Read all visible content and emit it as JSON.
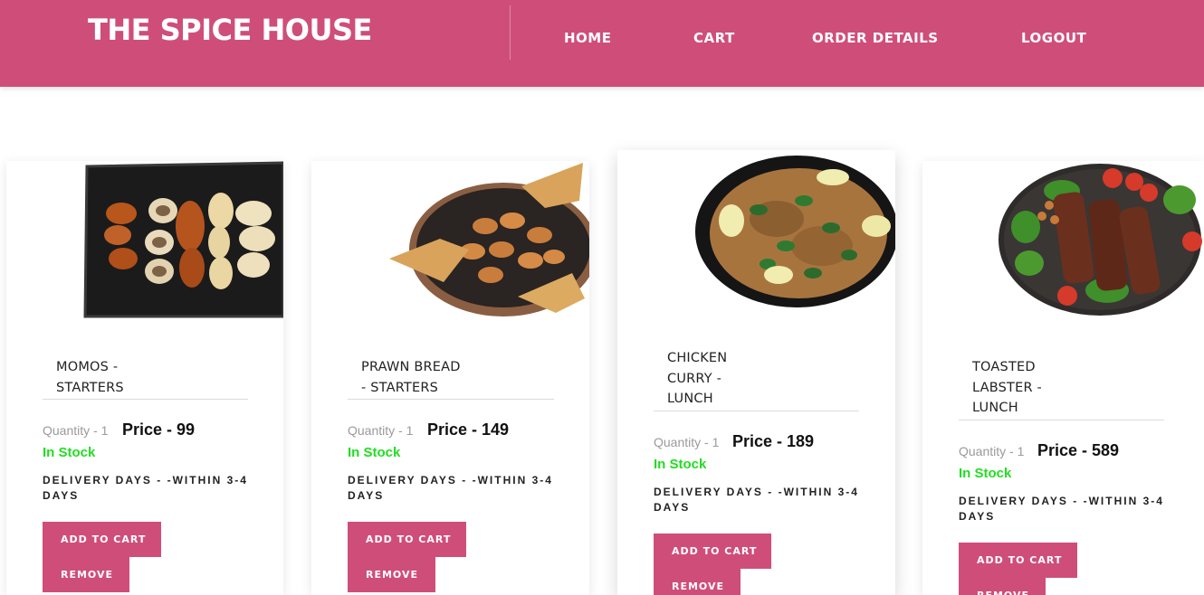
{
  "header": {
    "brand": "THE SPICE HOUSE",
    "nav": [
      "HOME",
      "CART",
      "ORDER DETAILS",
      "LOGOUT"
    ]
  },
  "colors": {
    "accent": "#cf4e79",
    "in_stock": "#22dd22"
  },
  "products": [
    {
      "name": "MOMOS -\nSTARTERS",
      "quantity": "Quantity - 1",
      "price": "Price - 99",
      "stock": "In Stock",
      "delivery": "DELIVERY DAYS - -WITHIN 3-4\nDAYS",
      "add": "ADD TO CART",
      "remove": "REMOVE"
    },
    {
      "name": "PRAWN BREAD\n- STARTERS",
      "quantity": "Quantity - 1",
      "price": "Price - 149",
      "stock": "In Stock",
      "delivery": "DELIVERY DAYS - -WITHIN 3-4\nDAYS",
      "add": "ADD TO CART",
      "remove": "REMOVE"
    },
    {
      "name": "CHICKEN\nCURRY -\nLUNCH",
      "quantity": "Quantity - 1",
      "price": "Price - 189",
      "stock": "In Stock",
      "delivery": "DELIVERY DAYS - -WITHIN 3-4\nDAYS",
      "add": "ADD TO CART",
      "remove": "REMOVE"
    },
    {
      "name": "TOASTED\nLABSTER -\nLUNCH",
      "quantity": "Quantity - 1",
      "price": "Price - 589",
      "stock": "In Stock",
      "delivery": "DELIVERY DAYS - -WITHIN 3-4\nDAYS",
      "add": "ADD TO CART",
      "remove": "REMOVE"
    }
  ]
}
